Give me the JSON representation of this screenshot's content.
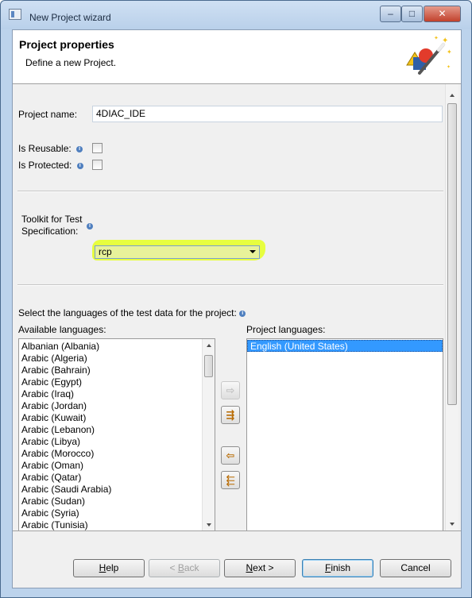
{
  "window": {
    "title": "New Project wizard",
    "minimize_glyph": "‒",
    "maximize_glyph": "□",
    "close_glyph": "✕"
  },
  "header": {
    "title": "Project properties",
    "description": "Define a new Project.",
    "icon": "wizard-wand-icon"
  },
  "form": {
    "project_name_label": "Project name:",
    "project_name_value": "4DIAC_IDE",
    "is_reusable_label": "Is Reusable:",
    "is_reusable_checked": false,
    "is_protected_label": "Is Protected:",
    "is_protected_checked": false,
    "toolkit_label_line1": "Toolkit for Test",
    "toolkit_label_line2": "Specification:",
    "toolkit_value": "rcp",
    "highlight_color": "#e6ff30",
    "languages_instruction": "Select the languages of the test data for the project:",
    "available_label": "Available languages:",
    "project_languages_label": "Project languages:",
    "info_icon_glyph": "i"
  },
  "available_languages": [
    "Albanian (Albania)",
    "Arabic (Algeria)",
    "Arabic (Bahrain)",
    "Arabic (Egypt)",
    "Arabic (Iraq)",
    "Arabic (Jordan)",
    "Arabic (Kuwait)",
    "Arabic (Lebanon)",
    "Arabic (Libya)",
    "Arabic (Morocco)",
    "Arabic (Oman)",
    "Arabic (Qatar)",
    "Arabic (Saudi Arabia)",
    "Arabic (Sudan)",
    "Arabic (Syria)",
    "Arabic (Tunisia)"
  ],
  "project_languages": [
    "English (United States)"
  ],
  "move_buttons": {
    "add_glyph": "⇨",
    "add_all_glyph": "⇶",
    "remove_glyph": "⇦",
    "remove_all_glyph": "⬱"
  },
  "buttons": {
    "help_mnemonic": "H",
    "help_rest": "elp",
    "back_prefix": "< ",
    "back_mnemonic": "B",
    "back_rest": "ack",
    "next_mnemonic": "N",
    "next_rest": "ext >",
    "finish_mnemonic": "F",
    "finish_rest": "inish",
    "cancel": "Cancel"
  },
  "colors": {
    "selection": "#3399ff",
    "title_bar": "#bcd3ec"
  }
}
